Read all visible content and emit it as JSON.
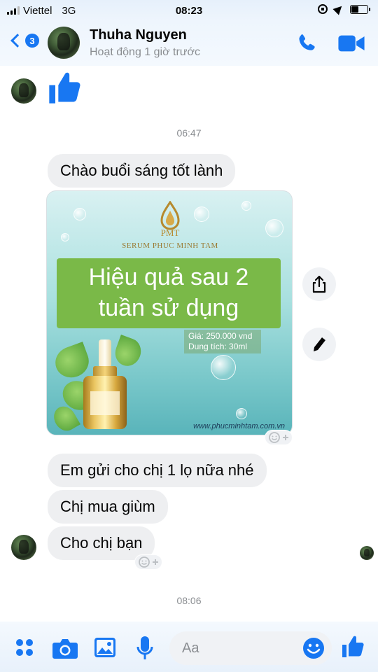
{
  "status_bar": {
    "carrier": "Viettel",
    "network": "3G",
    "time": "08:23"
  },
  "header": {
    "back_badge_count": "3",
    "contact_name": "Thuha Nguyen",
    "contact_status": "Hoạt động 1 giờ trước",
    "icons": [
      "back-chevron-icon",
      "phone-icon",
      "video-camera-icon"
    ]
  },
  "conversation": {
    "timestamps": [
      "06:47",
      "08:06"
    ],
    "messages": [
      {
        "type": "like"
      },
      {
        "type": "text",
        "text": "Chào buổi sáng tốt lành"
      },
      {
        "type": "image"
      },
      {
        "type": "text",
        "text": "Em gửi cho chị 1 lọ nữa nhé"
      },
      {
        "type": "text",
        "text": "Chị mua giùm"
      },
      {
        "type": "text",
        "text": "Cho chị bạn"
      }
    ],
    "image_card": {
      "logo_text": "PMT",
      "brand": "SERUM PHUC MINH TAM",
      "headline_line1": "Hiệu quả sau 2",
      "headline_line2": "tuần sử dụng",
      "price": "Giá: 250.000 vnd",
      "volume": "Dung tích: 30ml",
      "url": "www.phucminhtam.com.vn"
    },
    "side_actions": [
      "share-icon",
      "edit-pencil-icon"
    ]
  },
  "composer": {
    "placeholder": "Aa",
    "icons": [
      "apps-grid-icon",
      "camera-icon",
      "image-icon",
      "microphone-icon",
      "emoji-icon",
      "thumbs-up-icon"
    ]
  },
  "colors": {
    "accent": "#1877f2",
    "bubble": "#eeeff1",
    "banner_green": "#7ab948"
  }
}
